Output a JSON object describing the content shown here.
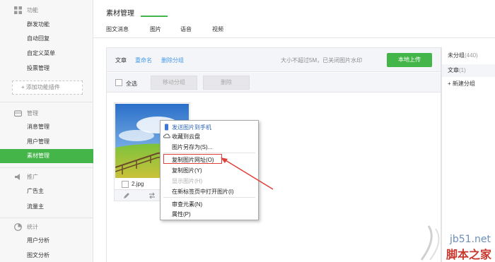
{
  "sidebar": {
    "sections": [
      {
        "title": "功能",
        "icon": "grid-icon"
      },
      {
        "title": "管理",
        "icon": "folder-icon"
      },
      {
        "title": "推广",
        "icon": "megaphone-icon"
      },
      {
        "title": "统计",
        "icon": "chart-icon"
      }
    ],
    "function_items": [
      "群发功能",
      "自动回复",
      "自定义菜单",
      "投票管理"
    ],
    "add_plugin": "+ 添加功能插件",
    "manage_items": [
      "消息管理",
      "用户管理",
      "素材管理"
    ],
    "promo_items": [
      "广告主",
      "流量主"
    ],
    "stats_items": [
      "用户分析",
      "图文分析"
    ]
  },
  "header": {
    "title": "素材管理",
    "tabs": [
      "图文消息",
      "图片",
      "语音",
      "视频"
    ],
    "active_tab": "图片"
  },
  "toolbar": {
    "label": "文章",
    "rename": "重命名",
    "delete_group": "删除分组",
    "hint": "大小不超过5M，已关闭图片水印",
    "upload": "本地上传"
  },
  "selbar": {
    "select_all": "全选",
    "move_group": "移动分组",
    "delete": "删除"
  },
  "card": {
    "filename": "2.jpg"
  },
  "groups": [
    {
      "name": "未分组",
      "count": "(440)"
    },
    {
      "name": "文章",
      "count": "(1)"
    },
    {
      "name": "+ 新建分组",
      "count": ""
    }
  ],
  "context_menu": {
    "items": [
      {
        "label": "发送图片到手机",
        "disabled": false
      },
      {
        "label": "收藏到云盘",
        "disabled": false
      },
      {
        "label": "图片另存为(S)...",
        "disabled": false
      },
      {
        "label": "复制图片网址(O)",
        "disabled": false
      },
      {
        "label": "复制图片(Y)",
        "disabled": false
      },
      {
        "label": "显示图片(H)",
        "disabled": true
      },
      {
        "label": "在新标签页中打开图片(I)",
        "disabled": false
      },
      {
        "label": "审查元素(N)",
        "disabled": false
      },
      {
        "label": "属性(P)",
        "disabled": false
      }
    ]
  },
  "watermark": {
    "site": "jb51.net",
    "name": "脚本之家"
  },
  "colors": {
    "accent": "#44b549",
    "link": "#459ae9",
    "highlight": "#e0403a"
  }
}
